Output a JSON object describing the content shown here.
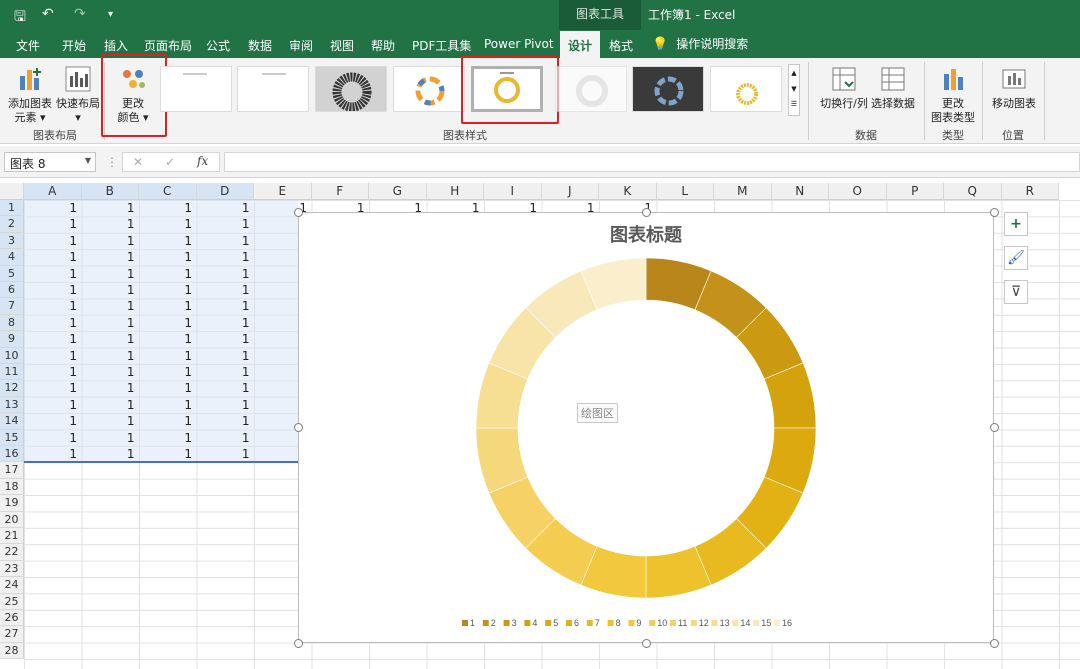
{
  "window": {
    "context_tab_title": "图表工具",
    "document_title": "工作簿1  -  Excel"
  },
  "quick_access": {
    "save": "🖫",
    "undo": "↶",
    "redo": "↷",
    "customize": "▾"
  },
  "tabs": [
    "文件",
    "开始",
    "插入",
    "页面布局",
    "公式",
    "数据",
    "审阅",
    "视图",
    "帮助",
    "PDF工具集",
    "Power Pivot",
    "设计",
    "格式"
  ],
  "active_tab": "设计",
  "tell_me": "操作说明搜索",
  "ribbon": {
    "add_element": [
      "添加图表",
      "元素 ▾"
    ],
    "quick_layout": [
      "快速布局",
      "▾"
    ],
    "change_color": [
      "更改",
      "颜色 ▾"
    ],
    "group_layout": "图表布局",
    "group_styles": "图表样式",
    "switch_row_col": "切换行/列",
    "select_data": "选择数据",
    "group_data": "数据",
    "change_type": [
      "更改",
      "图表类型"
    ],
    "group_type": "类型",
    "move_chart": "移动图表",
    "group_location": "位置"
  },
  "formula_bar": {
    "name_box": "图表 8",
    "fx": "fx",
    "cancel": "✕",
    "enter": "✓"
  },
  "columns": [
    "A",
    "B",
    "C",
    "D",
    "E",
    "F",
    "G",
    "H",
    "I",
    "J",
    "K",
    "L",
    "M",
    "N",
    "O",
    "P",
    "Q",
    "R"
  ],
  "rows": [
    "1",
    "2",
    "3",
    "4",
    "5",
    "6",
    "7",
    "8",
    "9",
    "10",
    "11",
    "12",
    "13",
    "14",
    "15",
    "16",
    "17",
    "18",
    "19",
    "20",
    "21",
    "22",
    "23",
    "24",
    "25",
    "26",
    "27",
    "28"
  ],
  "cell_value": "1",
  "chart": {
    "title": "图表标题",
    "plot_area_label": "绘图区",
    "side_buttons": [
      "+",
      "🖌",
      "⊽"
    ]
  },
  "chart_data": {
    "type": "pie",
    "variant": "doughnut",
    "title": "图表标题",
    "categories": [
      "1",
      "2",
      "3",
      "4",
      "5",
      "6",
      "7",
      "8",
      "9",
      "10",
      "11",
      "12",
      "13",
      "14",
      "15",
      "16"
    ],
    "values": [
      1,
      1,
      1,
      1,
      1,
      1,
      1,
      1,
      1,
      1,
      1,
      1,
      1,
      1,
      1,
      1
    ],
    "legend_position": "bottom",
    "colors": [
      "#b8861a",
      "#c4921a",
      "#cc9a10",
      "#d4a20c",
      "#dcaa0e",
      "#e2b214",
      "#e8ba20",
      "#eec22c",
      "#f2c83c",
      "#f4cc50",
      "#f6d266",
      "#f6d87c",
      "#f6de92",
      "#f8e4a8",
      "#f8e8ba",
      "#fbeecc"
    ]
  }
}
